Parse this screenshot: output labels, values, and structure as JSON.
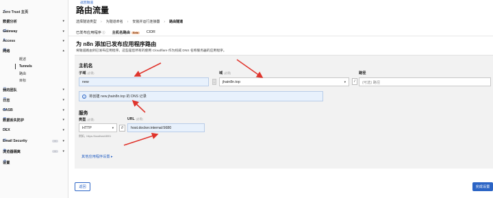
{
  "sidebar": {
    "items": [
      {
        "label": "Zero Trust 主页",
        "icon": "home-icon"
      },
      {
        "label": "数据分析",
        "icon": "chart-icon"
      },
      {
        "label": "Gateway",
        "icon": "gateway-icon"
      },
      {
        "label": "Access",
        "icon": "access-icon"
      },
      {
        "label": "网络",
        "icon": "network-icon"
      },
      {
        "label": "我的团队",
        "icon": "team-icon"
      },
      {
        "label": "日志",
        "icon": "logs-icon"
      },
      {
        "label": "CASB",
        "icon": "casb-icon"
      },
      {
        "label": "数据丢失防护",
        "icon": "dlp-icon"
      },
      {
        "label": "DEX",
        "icon": "dex-icon"
      },
      {
        "label": "Email Security",
        "icon": "email-icon"
      },
      {
        "label": "浏览器隔离",
        "icon": "browser-icon"
      },
      {
        "label": "设置",
        "icon": "settings-icon"
      }
    ],
    "sub_items": [
      "概述",
      "Tunnels",
      "路由",
      "目标"
    ]
  },
  "header": {
    "back_link": "返回隧道",
    "title": "路由流量"
  },
  "steps": [
    "选择隧道类型",
    "为隧道命名",
    "安装并运行连接器",
    "路由隧道"
  ],
  "tabs": {
    "published": "已发布应用程序",
    "hostname": "主机名路由",
    "beta": "Beta",
    "cidr": "CIDR"
  },
  "section": {
    "title": "为 n8n 添加已发布应用程序路由",
    "desc": "将隧道路由到已发布应用程序。这些是您所有的使用 Cloudflare 作为权威 DNS 名称服务器的应用程序。"
  },
  "form": {
    "hostname_group": "主机名",
    "subdomain_label": "子域",
    "subdomain_optional": "(必需)",
    "subdomain_value": "new",
    "domain_label": "域",
    "domain_required": "(必需)",
    "domain_value": "jhain8n.top",
    "path_label": "路径",
    "path_placeholder": "(可选) 路径",
    "dns_notice": "将创建 new.jhain8n.top 的 DNS 记录",
    "service_group": "服务",
    "type_label": "类型",
    "type_required": "(必需)",
    "type_value": "HTTP",
    "url_label": "URL",
    "url_required": "(必需)",
    "url_value": "host.docker.internal:5680",
    "url_hint": "例如，https://localhost:8001",
    "more_settings": "其他应用程序设置"
  },
  "buttons": {
    "back": "返回",
    "finish": "完成设置"
  },
  "colors": {
    "accent": "#2b64c5",
    "annotation_arrow": "#e0342c"
  }
}
